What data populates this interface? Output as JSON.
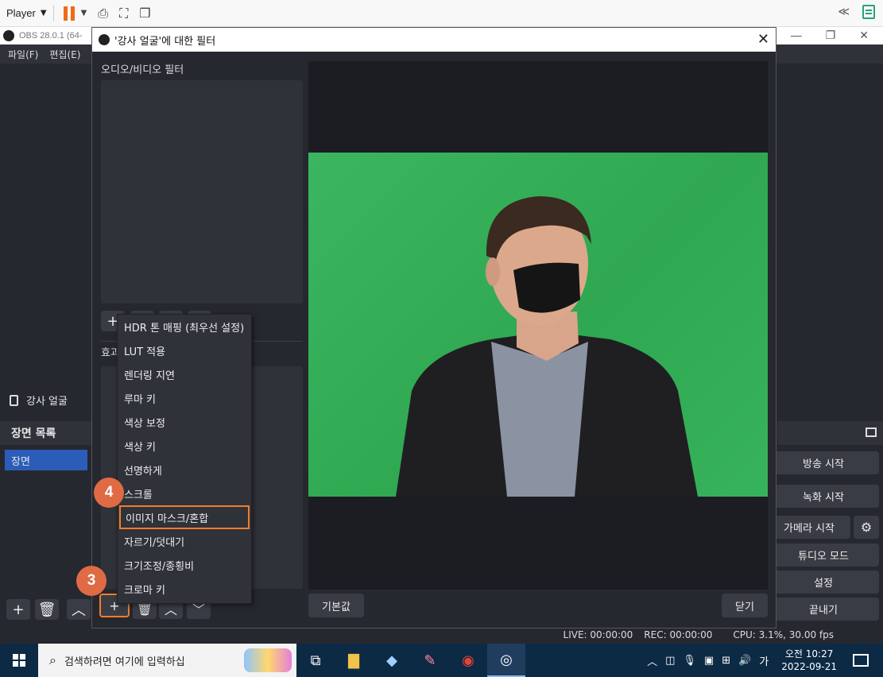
{
  "player": {
    "label": "Player"
  },
  "obs": {
    "title": "OBS 28.0.1 (64-",
    "menu": [
      "파일(F)",
      "편집(E)"
    ],
    "source_name": "강사 얼굴",
    "scenes_header": "장면 목록",
    "scene_item": "장면",
    "controls": [
      "방송 시작",
      "녹화 시작",
      "가메라 시작",
      "튜디오 모드",
      "설정",
      "끝내기"
    ],
    "status": {
      "live": "LIVE: 00:00:00",
      "rec": "REC: 00:00:00",
      "cpu": "CPU: 3.1%, 30.00 fps"
    }
  },
  "dialog": {
    "title": "'강사 얼굴'에 대한 필터",
    "av_label": "오디오/비디오 필터",
    "fx_label": "효과",
    "default_btn": "기본값",
    "close_btn": "닫기"
  },
  "menu": {
    "items": [
      "HDR 톤 매핑 (최우선 설정)",
      "LUT 적용",
      "렌더링 지연",
      "루마 키",
      "색상 보정",
      "색상 키",
      "선명하게",
      "스크롤",
      "이미지 마스크/혼합",
      "자르기/덧대기",
      "크기조정/종횡비",
      "크로마 키"
    ],
    "highlighted": "이미지 마스크/혼합"
  },
  "badges": {
    "step3": "3",
    "step4": "4"
  },
  "taskbar": {
    "search_placeholder": "검색하려면 여기에 입력하십",
    "ime": "가",
    "time": "오전 10:27",
    "date": "2022-09-21"
  },
  "colors": {
    "accent": "#f07d2a",
    "badge": "#e06a44",
    "green_screen": "#35b05a",
    "selected": "#2b5cb8"
  }
}
